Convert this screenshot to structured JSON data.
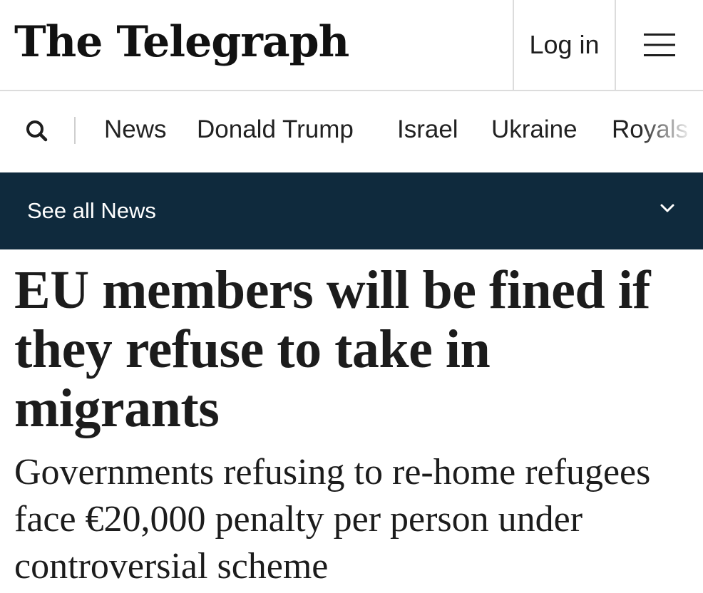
{
  "header": {
    "logo_text": "The Telegraph",
    "login_label": "Log in",
    "menu_icon": "hamburger-menu-icon"
  },
  "nav": {
    "search_icon": "search-icon",
    "items": [
      {
        "label": "News"
      },
      {
        "label": "Donald Trump"
      },
      {
        "label": "Israel"
      },
      {
        "label": "Ukraine"
      },
      {
        "label": "Royals"
      }
    ]
  },
  "section_bar": {
    "label": "See all News",
    "icon": "chevron-down-icon",
    "background": "#0f2a3d"
  },
  "article": {
    "headline": "EU members will be fined if they refuse to take in migrants",
    "standfirst": "Governments refusing to re-home refugees face €20,000 penalty per person under controversial scheme"
  }
}
